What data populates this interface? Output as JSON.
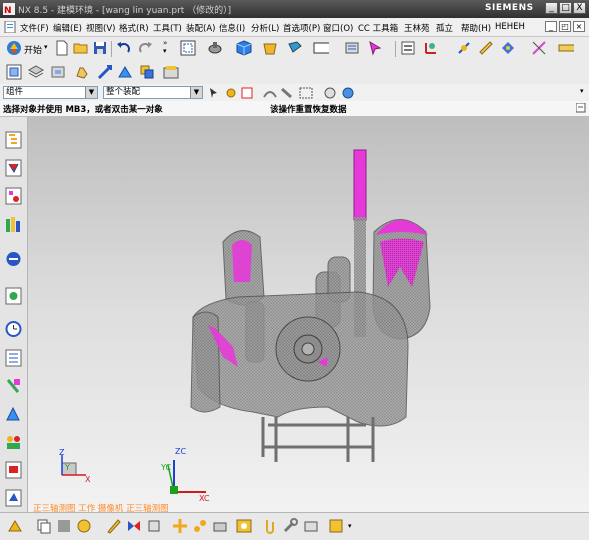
{
  "title_bar": {
    "title": "NX 8.5 - 建模环境 - [wang lin yuan.prt （修改的）]",
    "brand": "SIEMENS",
    "min": "_",
    "max": "□",
    "close": "X"
  },
  "menu": {
    "items": [
      "文件(F)",
      "编辑(E)",
      "视图(V)",
      "格式(R)",
      "工具(T)",
      "装配(A)",
      "信息(I)",
      "分析(L)",
      "首选项(P)",
      "窗口(O)",
      "CC 工具箱",
      "王林苑",
      "孤立",
      "帮助(H)",
      "HEHEH"
    ],
    "mdi_min": "_",
    "mdi_restore": "◰",
    "mdi_close": "×"
  },
  "toolbar": {
    "start_label": "开始"
  },
  "selection_bar": {
    "filter_value": "组件",
    "scope_value": "整个装配"
  },
  "cue_line": {
    "cue": "选择对象并使用 MB3，或者双击某一对象",
    "status": "该操作重置恢复数据"
  },
  "viewport": {
    "status_text": "正三轴测图 工作 摄像机 正三轴测图",
    "triad_small": {
      "z": "Z",
      "y": "Y",
      "x": "X"
    },
    "triad_big": {
      "zc": "ZC",
      "yc": "YC",
      "xc": "XC"
    }
  },
  "colors": {
    "model_gray": "#8a8a8a",
    "highlight": "#e53ad8",
    "status_text": "#ff8a2a",
    "axis_x": "#d21c1c",
    "axis_y": "#1aa01a",
    "axis_z": "#1a3fd2"
  },
  "icons": [
    "new-file-icon",
    "open-folder-icon",
    "save-icon",
    "undo-icon",
    "redo-icon",
    "fit-view-icon",
    "render-style-icon",
    "shaded-cube-icon",
    "orient-view-icon",
    "layer-icon",
    "measure-icon",
    "assembly-icon",
    "part-navigator-icon",
    "history-icon",
    "roles-icon",
    "ruler-icon",
    "snap-point-icon"
  ]
}
